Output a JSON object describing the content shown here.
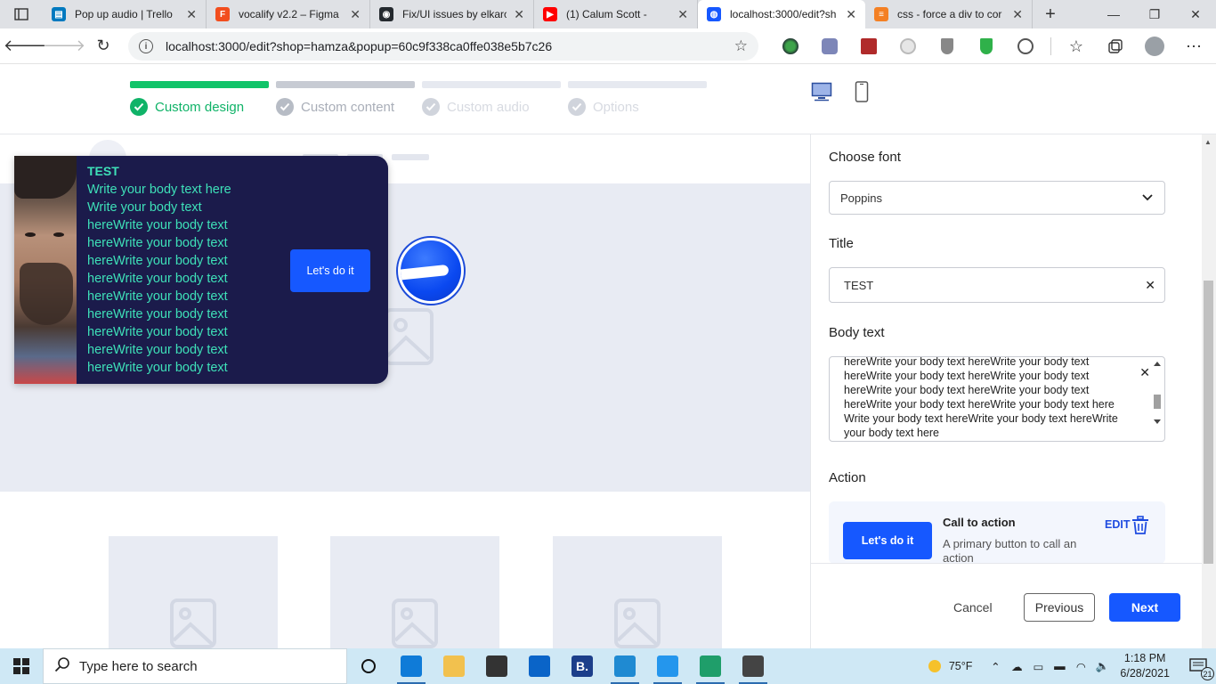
{
  "browser": {
    "tabs": [
      {
        "title": "Pop up audio | Trello",
        "favicon_color": "#0079bf",
        "favicon_glyph": "▤"
      },
      {
        "title": "vocalify v2.2 – Figma",
        "favicon_color": "#f24e1e",
        "favicon_glyph": "F"
      },
      {
        "title": "Fix/UI issues by elkarc",
        "favicon_color": "#24292e",
        "favicon_glyph": "◉"
      },
      {
        "title": "(1) Calum Scott -",
        "favicon_color": "#ff0000",
        "favicon_glyph": "▶"
      },
      {
        "title": "localhost:3000/edit?sh",
        "favicon_color": "#1658ff",
        "favicon_glyph": "◍",
        "active": true
      },
      {
        "title": "css - force a div to cor",
        "favicon_color": "#f48024",
        "favicon_glyph": "≡"
      }
    ],
    "url": "localhost:3000/edit?shop=hamza&popup=60c9f338ca0ffe038e5b7c26",
    "extensions": [
      "globe-extension-icon",
      "user-extension-icon",
      "red-square-extension-icon",
      "circle-extension-icon",
      "shield-extension-icon",
      "green-shield-extension-icon",
      "dots-circle-extension-icon"
    ]
  },
  "steps": [
    {
      "label": "Custom design",
      "state": "done",
      "bar_color": "#10c469",
      "text_color": "#10b368",
      "check_color": "#10b368"
    },
    {
      "label": "Custom content",
      "state": "current",
      "bar_color": "#c7cbd3",
      "text_color": "#a9aeb8",
      "check_color": "#b7bcc5"
    },
    {
      "label": "Custom audio",
      "state": "pending",
      "bar_color": "#e6e9f0",
      "text_color": "#d7dae1",
      "check_color": "#d0d4dc"
    },
    {
      "label": "Options",
      "state": "pending",
      "bar_color": "#e6e9f0",
      "text_color": "#d7dae1",
      "check_color": "#d0d4dc"
    }
  ],
  "popup": {
    "title": "TEST",
    "body": "Write your body text here Write your body text hereWrite your body text hereWrite your body text hereWrite your body text hereWrite your body text hereWrite your body text hereWrite your body text hereWrite your body text hereWrite your body text hereWrite your body text",
    "cta_label": "Let's do it",
    "background": "#1b1b4b",
    "text_color": "#3ee0b8"
  },
  "settings": {
    "font_label": "Choose font",
    "font_value": "Poppins",
    "title_label": "Title",
    "title_value": "TEST",
    "body_label": "Body text",
    "body_value": "hereWrite your body text hereWrite your body text hereWrite your body text hereWrite your body text hereWrite your body text hereWrite your body text hereWrite your body text hereWrite your body text here Write your body text hereWrite your body text hereWrite your body text here",
    "action_label": "Action",
    "action": {
      "button_label": "Let's do it",
      "title": "Call to action",
      "description": "A primary button to call an action",
      "edit_label": "EDIT"
    },
    "cancel_label": "Cancel",
    "previous_label": "Previous",
    "next_label": "Next",
    "accent": "#1658ff"
  },
  "taskbar": {
    "search_placeholder": "Type here to search",
    "weather": "75°F",
    "time": "1:18 PM",
    "date": "6/28/2021",
    "notifications": "21",
    "apps": [
      {
        "name": "cortana-icon",
        "color": "#111111",
        "shape": "ring"
      },
      {
        "name": "edge-icon",
        "color": "#0f7bd8",
        "running": true
      },
      {
        "name": "file-explorer-icon",
        "color": "#f2c14e"
      },
      {
        "name": "store-icon",
        "color": "#333333"
      },
      {
        "name": "mail-icon",
        "color": "#0a64c8"
      },
      {
        "name": "b-app-icon",
        "color": "#1c3e8a",
        "glyph": "B."
      },
      {
        "name": "vscode-icon",
        "color": "#1f8ad2",
        "running": true
      },
      {
        "name": "docker-icon",
        "color": "#2496ed",
        "running": true
      },
      {
        "name": "edge-dev-icon",
        "color": "#1f9e6a",
        "running": true
      },
      {
        "name": "calculator-icon",
        "color": "#444444",
        "running": true
      }
    ]
  }
}
